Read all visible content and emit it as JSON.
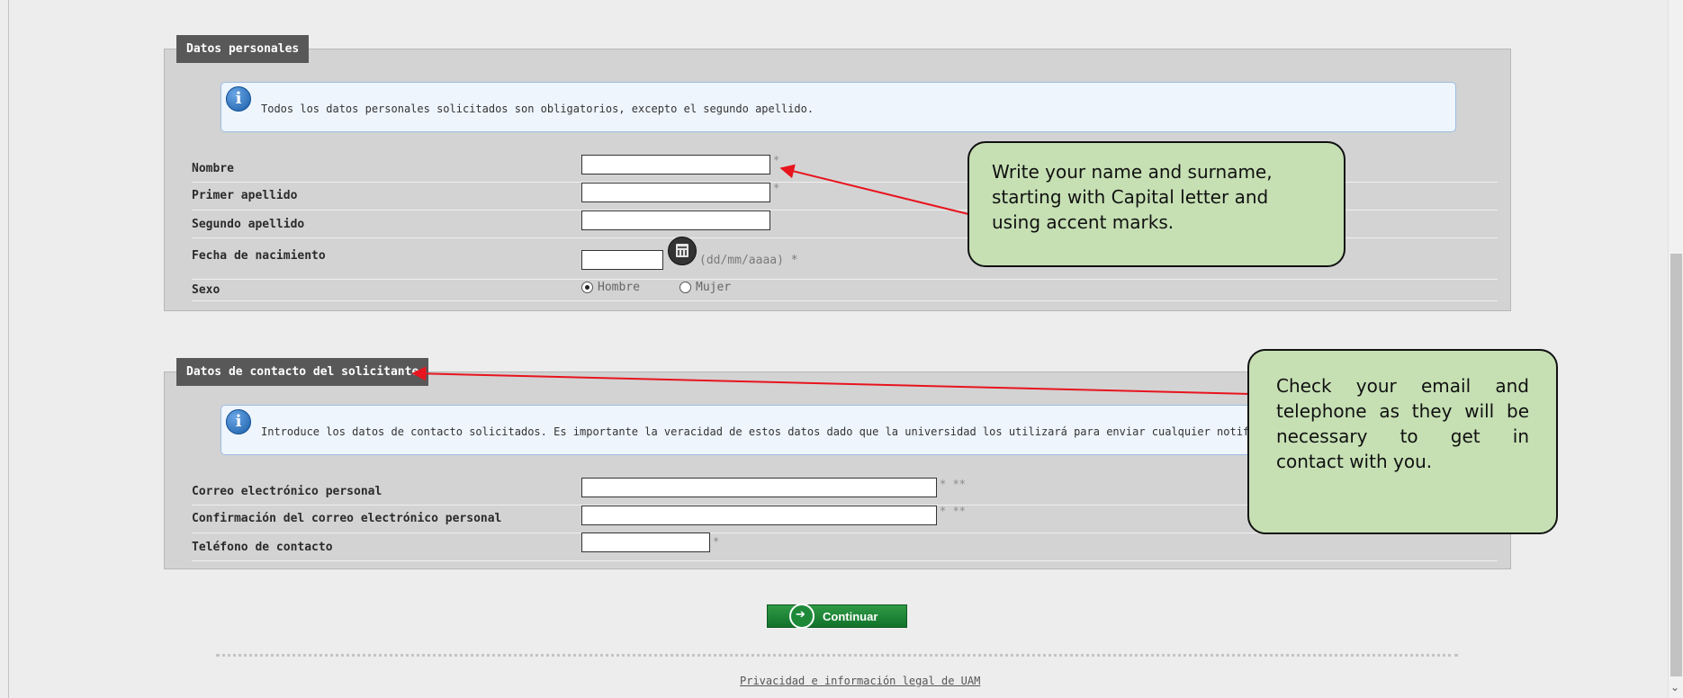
{
  "personal": {
    "legend": "Datos personales",
    "info": "Todos los datos personales solicitados son obligatorios, excepto el segundo apellido.",
    "fields": {
      "nombre": {
        "label": "Nombre",
        "value": "",
        "req": "*"
      },
      "primer_apellido": {
        "label": "Primer apellido",
        "value": "",
        "req": "*"
      },
      "segundo_apellido": {
        "label": "Segundo apellido",
        "value": ""
      },
      "fecha": {
        "label": "Fecha de nacimiento",
        "value": "",
        "hint": "(dd/mm/aaaa) *"
      },
      "sexo": {
        "label": "Sexo",
        "options": [
          "Hombre",
          "Mujer"
        ],
        "selected": "Hombre"
      }
    }
  },
  "contact": {
    "legend": "Datos de contacto del solicitante",
    "info": "Introduce los datos de contacto solicitados. Es importante la veracidad de estos datos dado que la universidad los utilizará para enviar cualquier notificación.",
    "fields": {
      "correo": {
        "label": "Correo electrónico personal",
        "value": "",
        "req": "*  **"
      },
      "confirmacion": {
        "label": "Confirmación del correo electrónico personal",
        "value": "",
        "req": "*  **"
      },
      "telefono": {
        "label": "Teléfono de contacto",
        "value": "",
        "req": "*"
      }
    }
  },
  "buttons": {
    "continue": "Continuar"
  },
  "footer": {
    "link": "Privacidad e información legal de  UAM"
  },
  "callouts": {
    "name": [
      "Write your name and surname,",
      "starting with Capital letter and",
      "using accent marks."
    ],
    "contact": [
      "Check your email and",
      "telephone as they will be",
      "necessary to get in",
      "contact with you."
    ]
  },
  "colors": {
    "callout_bg": "#c6e0b4",
    "arrow": "#e8141e",
    "button": "#1e8a39",
    "legend_bg": "#585858"
  }
}
